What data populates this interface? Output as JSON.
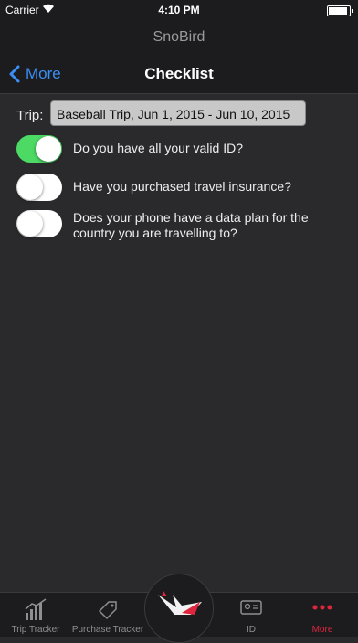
{
  "status": {
    "carrier": "Carrier",
    "time": "4:10 PM"
  },
  "app_title": "SnoBird",
  "nav": {
    "back_label": "More",
    "title": "Checklist"
  },
  "trip": {
    "label": "Trip:",
    "value": "Baseball Trip, Jun 1, 2015 - Jun 10, 2015"
  },
  "checklist": [
    {
      "text": "Do you have all your valid ID?",
      "on": true
    },
    {
      "text": "Have you purchased travel insurance?",
      "on": false
    },
    {
      "text": "Does your phone have a data plan for the country you are travelling to?",
      "on": false
    }
  ],
  "tabs": [
    {
      "label": "Trip Tracker",
      "icon": "chart-icon"
    },
    {
      "label": "Purchase Tracker",
      "icon": "price-tag-icon"
    },
    {
      "label": "",
      "icon": "snobird-logo-icon"
    },
    {
      "label": "ID",
      "icon": "id-card-icon"
    },
    {
      "label": "More",
      "icon": "more-dots-icon",
      "active": true
    }
  ],
  "colors": {
    "accent": "#3b8ef5",
    "toggle_on": "#4cd964",
    "tab_active": "#e0263e"
  }
}
